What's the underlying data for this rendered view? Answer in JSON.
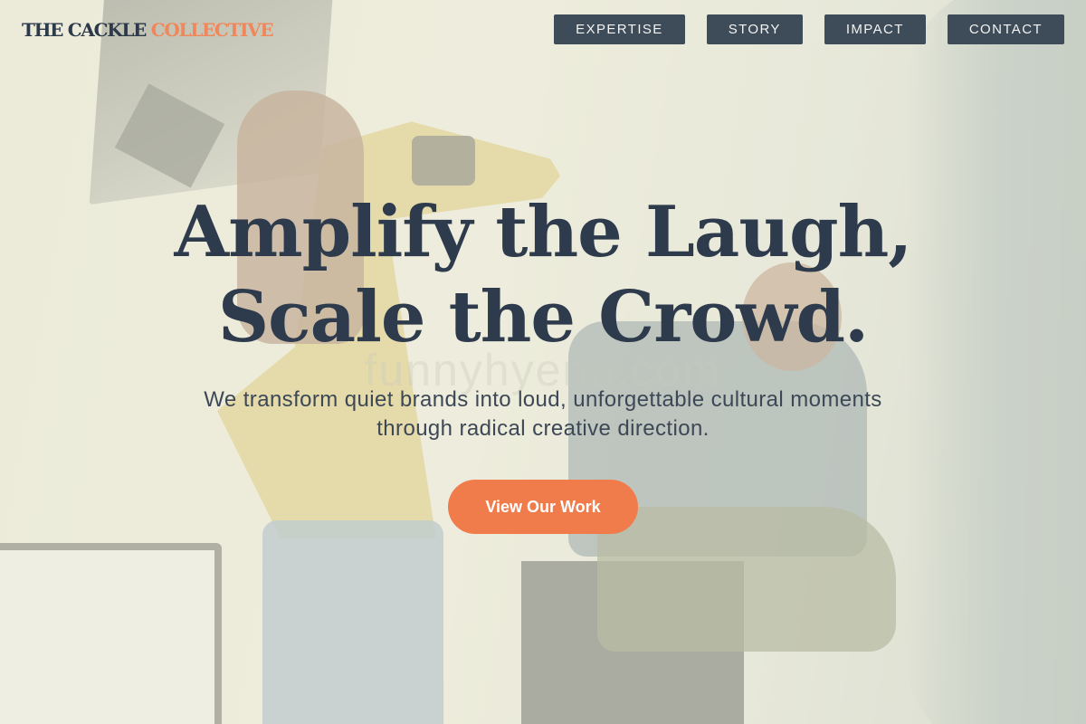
{
  "brand": {
    "name_part1": "THE CACKLE",
    "name_part2": "COLLECTIVE",
    "color_primary": "#2d3a4a",
    "color_accent": "#f0875a"
  },
  "nav": {
    "items": [
      {
        "label": "EXPERTISE"
      },
      {
        "label": "STORY"
      },
      {
        "label": "IMPACT"
      },
      {
        "label": "CONTACT"
      }
    ]
  },
  "hero": {
    "headline_line1": "Amplify the Laugh,",
    "headline_line2": "Scale the Crowd.",
    "watermark": "funnyhyena.com",
    "subline_line1": "We transform quiet brands into loud, unforgettable cultural moments",
    "subline_line2": "through radical creative direction.",
    "cta_label": "View Our Work",
    "cta_color": "#f07c4c"
  }
}
